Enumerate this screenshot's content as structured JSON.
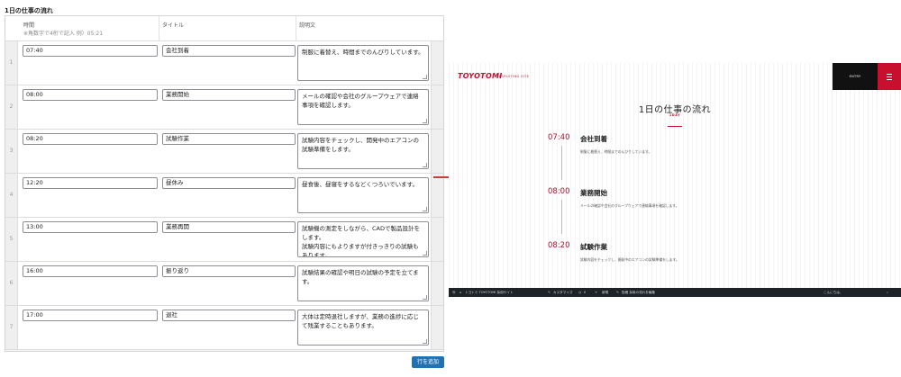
{
  "admin": {
    "section_title": "1日の仕事の流れ",
    "columns": {
      "time": "時間",
      "time_note": "※角数字で4桁で記入 例）05:21",
      "title": "タイトル",
      "description": "説明文"
    },
    "rows": [
      {
        "num": "1",
        "time": "07:40",
        "title": "会社到着",
        "desc": "制服に着替え、時間までのんびりしています。"
      },
      {
        "num": "2",
        "time": "08:00",
        "title": "業務開始",
        "desc": "メールの確認や会社のグループウェアで連絡事項を確認します。"
      },
      {
        "num": "3",
        "time": "08:20",
        "title": "試験作業",
        "desc": "試験内容をチェックし、開発中のエアコンの試験準備をします。"
      },
      {
        "num": "4",
        "time": "12:20",
        "title": "昼休み",
        "desc": "昼食後、昼寝をするなどくつろいでいます。"
      },
      {
        "num": "5",
        "time": "13:00",
        "title": "業務再開",
        "desc": "試験機の測定をしながら、CADで製品設計をします。\n試験内容にもよりますが付きっきりの試験もあります。"
      },
      {
        "num": "6",
        "time": "16:00",
        "title": "振り返り",
        "desc": "試験結果の確認や明日の試験の予定を立てます。"
      },
      {
        "num": "7",
        "time": "17:00",
        "title": "退社",
        "desc": "大体は定時退社しますが、業務の進捗に応じて残業することもあります。"
      }
    ],
    "add_row_label": "行を追加"
  },
  "site": {
    "logo": "TOYOTOMI",
    "logo_sub": "RECRUITING SITE",
    "entry_label": "ENTRY",
    "title": "1日の仕事の流れ",
    "subtitle": "1DAY",
    "timeline": [
      {
        "time": "07:40",
        "title": "会社到着",
        "desc": "制服に着替え、時間までのんびりしています。"
      },
      {
        "time": "08:00",
        "title": "業務開始",
        "desc": "メールの確認や会社のグループウェアで連絡事項を確認します。"
      },
      {
        "time": "08:20",
        "title": "試験作業",
        "desc": "試験内容をチェックし、開発中のエアコンの試験準備をします。"
      }
    ],
    "admin_bar": {
      "site_name": "トヨトミ TOYOTOMI 採用サイト",
      "customize": "カスタマイズ",
      "comments": "0",
      "new": "新規",
      "edit": "投稿 採用の流れを編集",
      "greeting": "こんにちは、"
    }
  },
  "colors": {
    "accent": "#c8102e",
    "button": "#2271b1",
    "arrow": "#d13a3a"
  }
}
